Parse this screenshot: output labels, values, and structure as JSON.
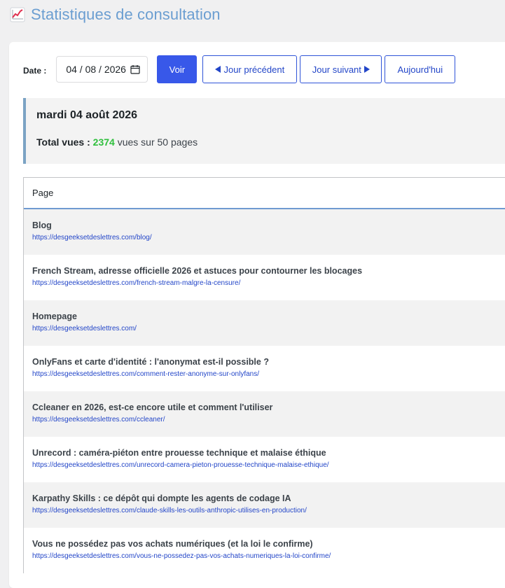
{
  "header": {
    "title": "Statistiques de consultation",
    "icon": "chart-increasing-icon"
  },
  "controls": {
    "date_label": "Date :",
    "date_value": "04 / 08 / 2026",
    "buttons": {
      "view": "Voir",
      "previous": "Jour précédent",
      "next": "Jour suivant",
      "today": "Aujourd'hui"
    }
  },
  "summary": {
    "date": "mardi 04 août 2026",
    "total_label": "Total vues :",
    "total_views": "2374",
    "suffix": "vues sur 50 pages"
  },
  "table": {
    "header_page": "Page",
    "rows": [
      {
        "title": "Blog",
        "url": "https://desgeeksetdeslettres.com/blog/"
      },
      {
        "title": "French Stream, adresse officielle 2026 et astuces pour contourner les blocages",
        "url": "https://desgeeksetdeslettres.com/french-stream-malgre-la-censure/"
      },
      {
        "title": "Homepage",
        "url": "https://desgeeksetdeslettres.com/"
      },
      {
        "title": "OnlyFans et carte d'identité : l'anonymat est-il possible ?",
        "url": "https://desgeeksetdeslettres.com/comment-rester-anonyme-sur-onlyfans/"
      },
      {
        "title": "Ccleaner en 2026, est-ce encore utile et comment l'utiliser",
        "url": "https://desgeeksetdeslettres.com/ccleaner/"
      },
      {
        "title": "Unrecord : caméra-piéton entre prouesse technique et malaise éthique",
        "url": "https://desgeeksetdeslettres.com/unrecord-camera-pieton-prouesse-technique-malaise-ethique/"
      },
      {
        "title": "Karpathy Skills : ce dépôt qui dompte les agents de codage IA",
        "url": "https://desgeeksetdeslettres.com/claude-skills-les-outils-anthropic-utilises-en-production/"
      },
      {
        "title": "Vous ne possédez pas vos achats numériques (et la loi le confirme)",
        "url": "https://desgeeksetdeslettres.com/vous-ne-possedez-pas-vos-achats-numeriques-la-loi-confirme/"
      }
    ]
  },
  "colors": {
    "title": "#6b9ed1",
    "primary": "#3858e9",
    "total_views": "#2fbf3d",
    "link": "#2346c8"
  }
}
